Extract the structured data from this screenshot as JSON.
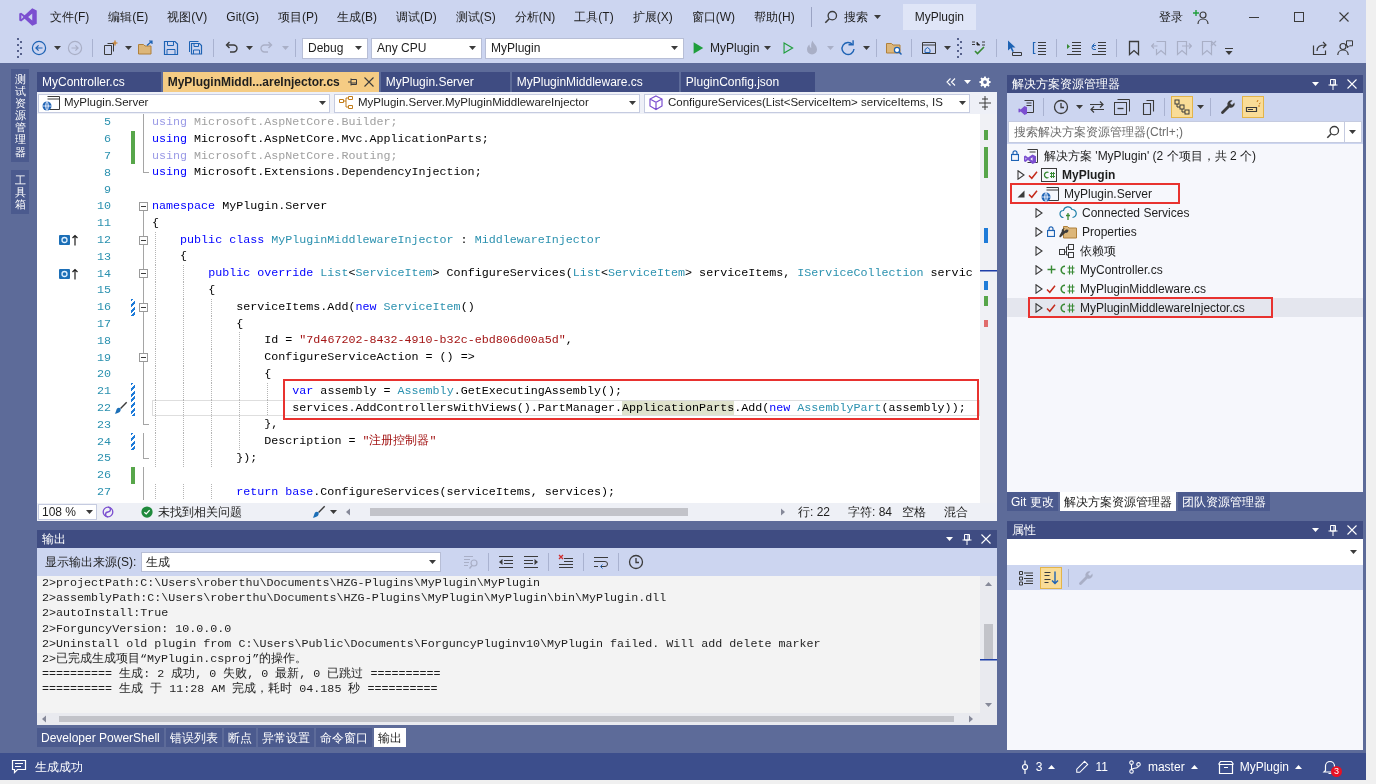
{
  "title_bar": {
    "menu": [
      "文件(F)",
      "编辑(E)",
      "视图(V)",
      "Git(G)",
      "项目(P)",
      "生成(B)",
      "调试(D)",
      "测试(S)",
      "分析(N)",
      "工具(T)",
      "扩展(X)",
      "窗口(W)",
      "帮助(H)"
    ],
    "search": "搜索",
    "solution_name": "MyPlugin",
    "sign_in": "登录"
  },
  "toolbar": [
    {
      "kind": "grip"
    },
    {
      "kind": "back",
      "disabled": false,
      "split": true
    },
    {
      "kind": "forward",
      "disabled": true
    },
    {
      "kind": "separator"
    },
    {
      "kind": "new-item",
      "disabled": false,
      "split": true
    },
    {
      "kind": "open",
      "disabled": false
    },
    {
      "kind": "save",
      "disabled": false
    },
    {
      "kind": "save-all",
      "disabled": false
    },
    {
      "kind": "separator"
    },
    {
      "kind": "undo",
      "disabled": false,
      "split": true
    },
    {
      "kind": "redo",
      "disabled": true,
      "split": true
    },
    {
      "kind": "separator"
    },
    {
      "kind": "combo",
      "value": "Debug"
    },
    {
      "kind": "combo",
      "value": "Any CPU"
    },
    {
      "kind": "combo",
      "value": "MyPlugin"
    },
    {
      "kind": "run",
      "label": "MyPlugin"
    },
    {
      "kind": "start-without-debugging",
      "disabled": false
    },
    {
      "kind": "hot-reload",
      "disabled": true,
      "split": true
    },
    {
      "kind": "restart",
      "disabled": false,
      "split": true
    },
    {
      "kind": "separator"
    },
    {
      "kind": "folder-search",
      "disabled": false
    },
    {
      "kind": "separator"
    },
    {
      "kind": "window-layout",
      "disabled": false,
      "split": true
    },
    {
      "kind": "grip"
    },
    {
      "kind": "spell-check",
      "disabled": false
    },
    {
      "kind": "separator"
    },
    {
      "kind": "select-pointer",
      "disabled": false
    },
    {
      "kind": "column-select",
      "disabled": false
    },
    {
      "kind": "separator"
    },
    {
      "kind": "indent",
      "disabled": false
    },
    {
      "kind": "outdent",
      "disabled": false
    },
    {
      "kind": "separator"
    },
    {
      "kind": "bookmark",
      "disabled": false
    },
    {
      "kind": "bookmark-previous",
      "disabled": true
    },
    {
      "kind": "bookmark-next",
      "disabled": true
    },
    {
      "kind": "bookmark-clear",
      "disabled": true
    },
    {
      "kind": "overflow"
    },
    {
      "kind": "spacer"
    },
    {
      "kind": "share",
      "disabled": false
    },
    {
      "kind": "feedback",
      "disabled": false
    }
  ],
  "side_tabs": [
    "测试资源管理器",
    "工具箱"
  ],
  "editor": {
    "tabs": [
      {
        "label": "MyController.cs",
        "selected": false
      },
      {
        "label": "MyPluginMiddl...areInjector.cs",
        "selected": true
      },
      {
        "label": "MyPlugin.Server",
        "selected": false
      },
      {
        "label": "MyPluginMiddleware.cs",
        "selected": false
      },
      {
        "label": "PluginConfig.json",
        "selected": false
      }
    ],
    "nav": [
      {
        "kind": "project",
        "text": "MyPlugin.Server"
      },
      {
        "kind": "class",
        "text": "MyPlugin.Server.MyPluginMiddlewareInjector"
      },
      {
        "kind": "method",
        "text": "ConfigureServices(List<ServiceItem> serviceItems, IS"
      }
    ],
    "lines": [
      {
        "number": "5",
        "tokens": [
          {
            "kind": "faded-keyword",
            "text": "using"
          },
          {
            "kind": "faded",
            "text": " Microsoft.AspNetCore.Builder;"
          }
        ]
      },
      {
        "number": "6",
        "added": true,
        "tokens": [
          {
            "kind": "keyword",
            "text": "using"
          },
          {
            "kind": "plain",
            "text": " Microsoft.AspNetCore.Mvc.ApplicationParts;"
          }
        ]
      },
      {
        "number": "7",
        "added": true,
        "tokens": [
          {
            "kind": "faded-keyword",
            "text": "using"
          },
          {
            "kind": "faded",
            "text": " Microsoft.AspNetCore.Routing;"
          }
        ]
      },
      {
        "number": "8",
        "region_end": true,
        "tokens": [
          {
            "kind": "keyword",
            "text": "using"
          },
          {
            "kind": "plain",
            "text": " Microsoft.Extensions.DependencyInjection;"
          }
        ]
      },
      {
        "number": "9"
      },
      {
        "number": "10",
        "collapsible": true,
        "tokens": [
          {
            "kind": "keyword",
            "text": "namespace"
          },
          {
            "kind": "plain",
            "text": " MyPlugin.Server"
          }
        ]
      },
      {
        "number": "11",
        "tokens": [
          {
            "kind": "plain",
            "text": "{"
          }
        ]
      },
      {
        "number": "12",
        "collapsible": true,
        "overrides": true,
        "tokens": [
          {
            "kind": "keyword",
            "text": "    public class "
          },
          {
            "kind": "type",
            "text": "MyPluginMiddlewareInjector"
          },
          {
            "kind": "plain",
            "text": " : "
          },
          {
            "kind": "type",
            "text": "MiddlewareInjector"
          }
        ]
      },
      {
        "number": "13",
        "tokens": [
          {
            "kind": "plain",
            "text": "    {"
          }
        ]
      },
      {
        "number": "14",
        "collapsible": true,
        "overrides": true,
        "tokens": [
          {
            "kind": "keyword",
            "text": "        public override "
          },
          {
            "kind": "type",
            "text": "List"
          },
          {
            "kind": "plain",
            "text": "<"
          },
          {
            "kind": "type",
            "text": "ServiceItem"
          },
          {
            "kind": "plain",
            "text": "> ConfigureServices("
          },
          {
            "kind": "type",
            "text": "List"
          },
          {
            "kind": "plain",
            "text": "<"
          },
          {
            "kind": "type",
            "text": "ServiceItem"
          },
          {
            "kind": "plain",
            "text": "> serviceItems, "
          },
          {
            "kind": "type",
            "text": "IServiceCollection"
          },
          {
            "kind": "plain",
            "text": " servic"
          }
        ]
      },
      {
        "number": "15",
        "tokens": [
          {
            "kind": "plain",
            "text": "        {"
          }
        ]
      },
      {
        "number": "16",
        "collapsible": true,
        "modified": true,
        "tokens": [
          {
            "kind": "plain",
            "text": "            serviceItems.Add("
          },
          {
            "kind": "keyword",
            "text": "new "
          },
          {
            "kind": "type",
            "text": "ServiceItem"
          },
          {
            "kind": "plain",
            "text": "()"
          }
        ]
      },
      {
        "number": "17",
        "tokens": [
          {
            "kind": "plain",
            "text": "            {"
          }
        ]
      },
      {
        "number": "18",
        "tokens": [
          {
            "kind": "plain",
            "text": "                Id = "
          },
          {
            "kind": "string",
            "text": "\"7d467202-8432-4910-b32c-ebd806d00a5d\""
          },
          {
            "kind": "plain",
            "text": ","
          }
        ]
      },
      {
        "number": "19",
        "collapsible": true,
        "tokens": [
          {
            "kind": "plain",
            "text": "                ConfigureServiceAction = () =>"
          }
        ]
      },
      {
        "number": "20",
        "tokens": [
          {
            "kind": "plain",
            "text": "                {"
          }
        ]
      },
      {
        "number": "21",
        "modified": true,
        "annotated": true,
        "tokens": [
          {
            "kind": "keyword",
            "text": "                    var"
          },
          {
            "kind": "plain",
            "text": " assembly = "
          },
          {
            "kind": "type",
            "text": "Assembly"
          },
          {
            "kind": "plain",
            "text": ".GetExecutingAssembly();"
          }
        ]
      },
      {
        "number": "22",
        "modified": true,
        "quick_action": true,
        "current": true,
        "annotated": true,
        "tokens": [
          {
            "kind": "plain",
            "text": "                    services.AddControllersWithViews().PartManager."
          },
          {
            "kind": "highlight",
            "text": "ApplicationParts"
          },
          {
            "kind": "plain",
            "text": ".Add("
          },
          {
            "kind": "keyword",
            "text": "new "
          },
          {
            "kind": "type",
            "text": "AssemblyPart"
          },
          {
            "kind": "plain",
            "text": "(assembly));"
          }
        ]
      },
      {
        "number": "23",
        "region_end": true,
        "tokens": [
          {
            "kind": "plain",
            "text": "                },"
          }
        ]
      },
      {
        "number": "24",
        "modified": true,
        "tokens": [
          {
            "kind": "plain",
            "text": "                Description = "
          },
          {
            "kind": "string",
            "text": "\"注册控制器\""
          }
        ]
      },
      {
        "number": "25",
        "region_end": true,
        "tokens": [
          {
            "kind": "plain",
            "text": "            });"
          }
        ]
      },
      {
        "number": "26",
        "added": true
      },
      {
        "number": "27",
        "tokens": [
          {
            "kind": "keyword",
            "text": "            return base"
          },
          {
            "kind": "plain",
            "text": ".ConfigureServices(serviceItems, services);"
          }
        ]
      }
    ],
    "status": {
      "zoom": "108 %",
      "issues": "未找到相关问题",
      "line": "行: 22",
      "column": "字符: 84",
      "indent": "空格",
      "line_endings": "混合"
    }
  },
  "output": {
    "title": "输出",
    "source_label": "显示输出来源(S):",
    "source": "生成",
    "toolbar": [
      {
        "kind": "find-message",
        "disabled": true
      },
      {
        "kind": "separator"
      },
      {
        "kind": "previous-message",
        "disabled": false
      },
      {
        "kind": "next-message",
        "disabled": false
      },
      {
        "kind": "separator"
      },
      {
        "kind": "clear-all",
        "disabled": false
      },
      {
        "kind": "separator"
      },
      {
        "kind": "word-wrap",
        "disabled": false
      },
      {
        "kind": "separator"
      },
      {
        "kind": "timestamps",
        "disabled": false
      }
    ],
    "lines": [
      "2>projectPath:C:\\Users\\roberthu\\Documents\\HZG-Plugins\\MyPlugin\\MyPlugin",
      "2>assemblyPath:C:\\Users\\roberthu\\Documents\\HZG-Plugins\\MyPlugin\\MyPlugin\\bin\\MyPlugin.dll",
      "2>autoInstall:True",
      "2>ForguncyVersion: 10.0.0.0",
      "2>Uninstall old plugin from C:\\Users\\Public\\Documents\\ForguncyPluginv10\\MyPlugin failed. Will add delete marker",
      "2>已完成生成项目“MyPlugin.csproj”的操作。",
      "========== 生成: 2 成功, 0 失败, 0 最新, 0 已跳过 ==========",
      "========== 生成 于 11:28 AM 完成，耗时 04.185 秒 =========="
    ]
  },
  "bottom_tabs": [
    {
      "label": "Developer PowerShell",
      "selected": false
    },
    {
      "label": "错误列表",
      "selected": false
    },
    {
      "label": "断点",
      "selected": false
    },
    {
      "label": "异常设置",
      "selected": false
    },
    {
      "label": "命令窗口",
      "selected": false
    },
    {
      "label": "输出",
      "selected": true
    }
  ],
  "solution_explorer": {
    "title": "解决方案资源管理器",
    "toolbar": [
      {
        "kind": "switch-views",
        "on": false
      },
      {
        "kind": "separator"
      },
      {
        "kind": "pending-changes",
        "on": false,
        "split": true
      },
      {
        "kind": "sync",
        "on": false
      },
      {
        "kind": "collapse-all",
        "on": false
      },
      {
        "kind": "show-all-files",
        "on": false
      },
      {
        "kind": "separator"
      },
      {
        "kind": "track-active",
        "on": true,
        "split": true
      },
      {
        "kind": "separator"
      },
      {
        "kind": "properties",
        "on": false
      },
      {
        "kind": "preview",
        "on": true
      }
    ],
    "search": {
      "placeholder": "搜索解决方案资源管理器(Ctrl+;)"
    },
    "tree": [
      {
        "label": "解决方案 'MyPlugin' (2 个项目，共 2 个)",
        "kind": "solution",
        "locked": true,
        "selected": false,
        "children": [
          {
            "label": "MyPlugin",
            "kind": "csharp-project",
            "committed": true,
            "expanded": false,
            "startup": true,
            "selected": false
          },
          {
            "label": "MyPlugin.Server",
            "kind": "web-project",
            "committed": true,
            "expanded": true,
            "startup": false,
            "annotated": true,
            "selected": false,
            "children": [
              {
                "label": "Connected Services",
                "kind": "connected-services",
                "expanded": false,
                "selected": false
              },
              {
                "label": "Properties",
                "kind": "properties",
                "locked": true,
                "expanded": false,
                "selected": false
              },
              {
                "label": "依赖项",
                "kind": "dependencies",
                "expanded": false,
                "selected": false
              },
              {
                "label": "MyController.cs",
                "kind": "csharp-file",
                "added": true,
                "expanded": false,
                "selected": false
              },
              {
                "label": "MyPluginMiddleware.cs",
                "kind": "csharp-file",
                "committed": true,
                "expanded": false,
                "selected": false
              },
              {
                "label": "MyPluginMiddlewareInjector.cs",
                "kind": "csharp-file",
                "committed": true,
                "expanded": false,
                "selected": true,
                "annotated": true
              }
            ]
          }
        ]
      }
    ],
    "tabs": [
      {
        "label": "Git 更改",
        "selected": false
      },
      {
        "label": "解决方案资源管理器",
        "selected": true
      },
      {
        "label": "团队资源管理器",
        "selected": false
      }
    ]
  },
  "properties": {
    "title": "属性",
    "toolbar": [
      {
        "kind": "categorized",
        "on": false,
        "disabled": false
      },
      {
        "kind": "alphabetical",
        "on": true,
        "disabled": false
      },
      {
        "kind": "separator"
      },
      {
        "kind": "property-pages",
        "on": false,
        "disabled": true
      }
    ]
  },
  "status_bar": {
    "message": "生成成功",
    "items": [
      {
        "kind": "commits",
        "label": "3"
      },
      {
        "kind": "changes",
        "label": "11"
      },
      {
        "kind": "branch",
        "label": "master"
      },
      {
        "kind": "repository",
        "label": "MyPlugin"
      }
    ],
    "notifications": "3"
  }
}
